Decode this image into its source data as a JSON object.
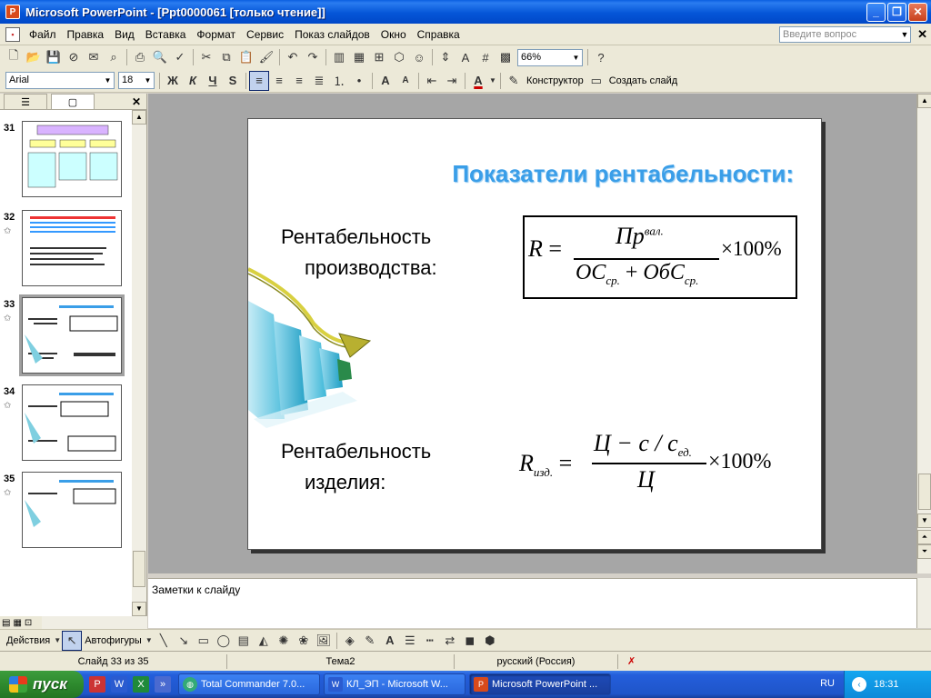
{
  "window": {
    "title": "Microsoft PowerPoint - [Ppt0000061 [только чтение]]"
  },
  "menu": {
    "items": [
      "Файл",
      "Правка",
      "Вид",
      "Вставка",
      "Формат",
      "Сервис",
      "Показ слайдов",
      "Окно",
      "Справка"
    ],
    "help_placeholder": "Введите вопрос"
  },
  "toolbar": {
    "zoom": "66%",
    "font": "Arial",
    "size": "18",
    "designer": "Конструктор",
    "new_slide": "Создать слайд"
  },
  "outline": {
    "thumbs": [
      {
        "num": "31"
      },
      {
        "num": "32",
        "star": "✩"
      },
      {
        "num": "33",
        "star": "✩"
      },
      {
        "num": "34",
        "star": "✩"
      },
      {
        "num": "35",
        "star": "✩"
      }
    ]
  },
  "slide": {
    "title": "Показатели рентабельности:",
    "label1_line1": "Рентабельность",
    "label1_line2": "производства:",
    "label2_line1": "Рентабельность",
    "label2_line2": "изделия:",
    "f1": {
      "lhs": "R",
      "num": "Пр",
      "sup": "вал.",
      "den1": "ОС",
      "sub1": "ср.",
      "den2": "ОбС",
      "sub2": "ср.",
      "mult": "×100%"
    },
    "f2": {
      "lhs": "R",
      "lsub": "изд.",
      "num": "Ц − с / с",
      "nsub": "ед.",
      "den": "Ц",
      "mult": "×100%"
    }
  },
  "notes": {
    "placeholder": "Заметки к слайду"
  },
  "drawbar": {
    "actions": "Действия",
    "autoshapes": "Автофигуры"
  },
  "status": {
    "slide": "Слайд 33 из 35",
    "design": "Тема2",
    "lang": "русский (Россия)"
  },
  "taskbar": {
    "start": "пуск",
    "tasks": [
      "Total Commander 7.0...",
      "КЛ_ЭП - Microsoft W...",
      "Microsoft PowerPoint ..."
    ],
    "lang": "RU",
    "time": "18:31"
  }
}
